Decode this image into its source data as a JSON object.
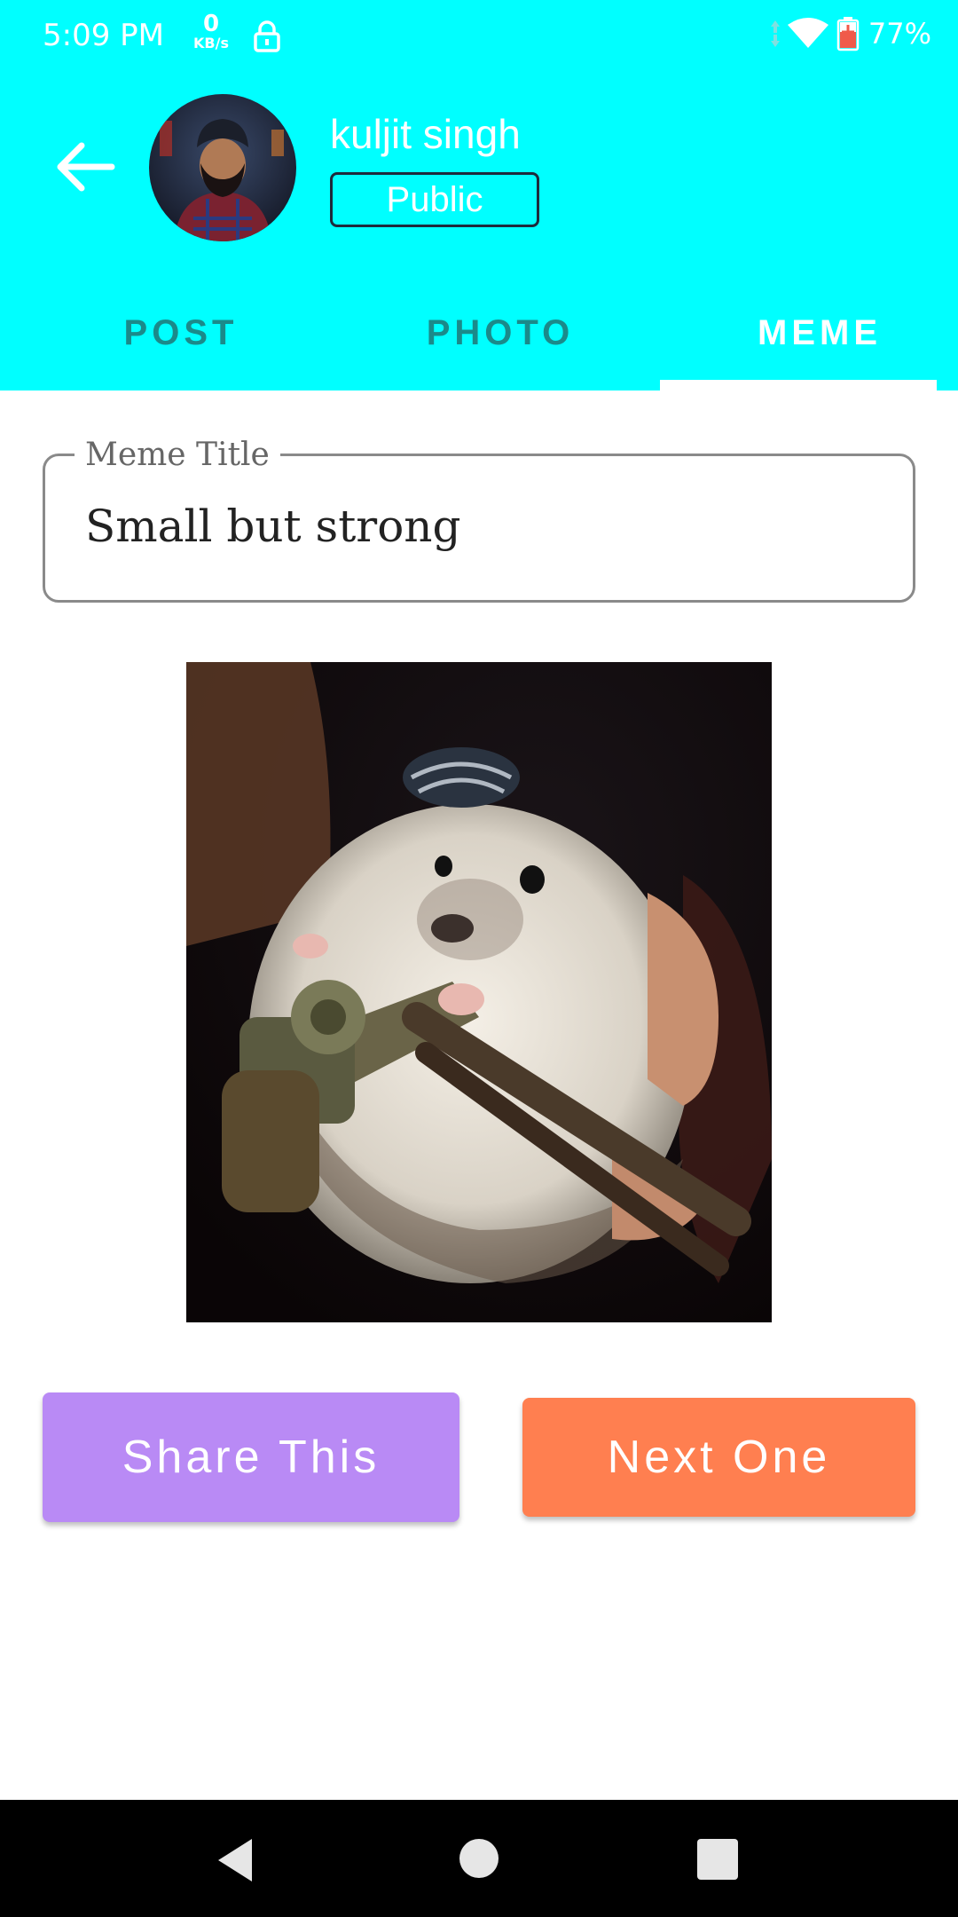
{
  "status_bar": {
    "time": "5:09 PM",
    "net_speed_value": "0",
    "net_speed_unit": "KB/s",
    "battery_percent": "77%",
    "icons": [
      "lock-icon",
      "data-arrows-icon",
      "wifi-icon",
      "battery-charging-icon"
    ]
  },
  "header": {
    "user_name": "kuljit singh",
    "visibility_badge": "Public",
    "back_icon": "arrow-left-icon"
  },
  "tabs": [
    {
      "label": "POST",
      "active": false
    },
    {
      "label": "PHOTO",
      "active": false
    },
    {
      "label": "MEME",
      "active": true
    }
  ],
  "meme_form": {
    "title_label": "Meme Title",
    "title_value": "Small but strong"
  },
  "actions": {
    "share_label": "Share This",
    "next_label": "Next One"
  },
  "colors": {
    "app_bar": "#00FFFF",
    "tab_inactive": "#1B8A8A",
    "share_button": "#B98AF5",
    "next_button": "#FF7F50",
    "nav_bar": "#000000"
  },
  "nav_bar": {
    "icons": [
      "nav-back-icon",
      "nav-home-icon",
      "nav-recents-icon"
    ]
  }
}
